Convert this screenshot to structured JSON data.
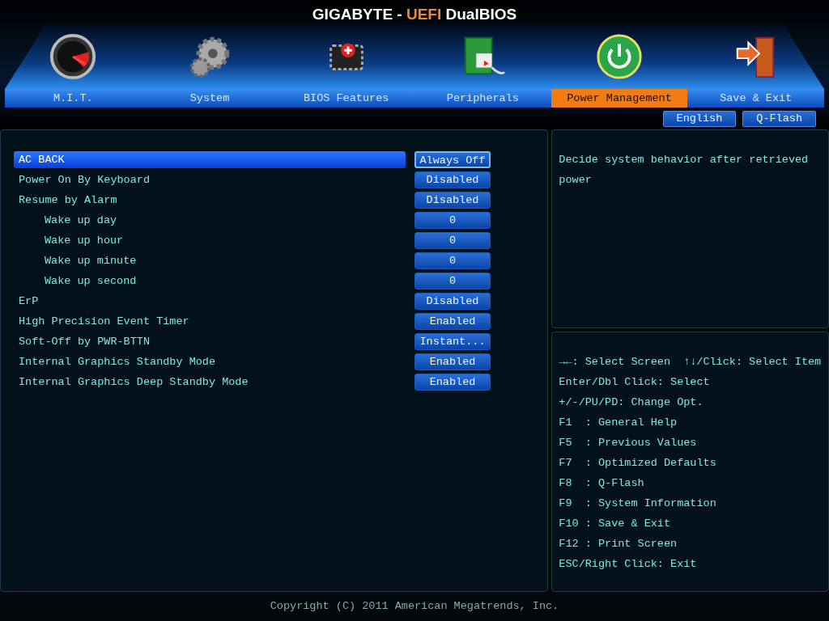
{
  "title": {
    "brand": "GIGABYTE - ",
    "accent": "UEFI",
    "product": " DualBIOS"
  },
  "tabs": [
    {
      "label": "M.I.T.",
      "kind": "gauge",
      "selected": false
    },
    {
      "label": "System",
      "kind": "gears",
      "selected": false
    },
    {
      "label": "BIOS Features",
      "kind": "chip",
      "selected": false
    },
    {
      "label": "Peripherals",
      "kind": "board",
      "selected": false
    },
    {
      "label": "Power Management",
      "kind": "power",
      "selected": true
    },
    {
      "label": "Save & Exit",
      "kind": "door",
      "selected": false
    }
  ],
  "top_buttons": [
    "English",
    "Q-Flash"
  ],
  "settings": [
    {
      "label": "AC BACK",
      "value": "Always Off",
      "selected": true
    },
    {
      "label": "Power On By Keyboard",
      "value": "Disabled",
      "selected": false
    },
    {
      "label": "Resume by Alarm",
      "value": "Disabled",
      "selected": false,
      "children": [
        {
          "label": "Wake up day",
          "value": "0",
          "selected": false
        },
        {
          "label": "Wake up hour",
          "value": "0",
          "selected": false
        },
        {
          "label": "Wake up minute",
          "value": "0",
          "selected": false
        },
        {
          "label": "Wake up second",
          "value": "0",
          "selected": false
        }
      ]
    },
    {
      "label": "ErP",
      "value": "Disabled",
      "selected": false
    },
    {
      "label": "High Precision Event Timer",
      "value": "Enabled",
      "selected": false
    },
    {
      "label": "Soft-Off by PWR-BTTN",
      "value": "Instant...",
      "selected": false
    },
    {
      "label": "Internal Graphics Standby Mode",
      "value": "Enabled",
      "selected": false
    },
    {
      "label": "Internal Graphics Deep Standby Mode",
      "value": "Enabled",
      "selected": false
    }
  ],
  "description": "Decide system behavior after retrieved power",
  "help": [
    [
      "→←: Select Screen",
      "↑↓/Click: Select Item"
    ],
    [
      "Enter/Dbl Click: Select"
    ],
    [
      "+/-/PU/PD: Change Opt."
    ],
    [
      "F1  : General Help"
    ],
    [
      "F5  : Previous Values"
    ],
    [
      "F7  : Optimized Defaults"
    ],
    [
      "F8  : Q-Flash"
    ],
    [
      "F9  : System Information"
    ],
    [
      "F10 : Save & Exit"
    ],
    [
      "F12 : Print Screen"
    ],
    [
      "ESC/Right Click: Exit"
    ]
  ],
  "footer": "Copyright (C) 2011 American Megatrends, Inc."
}
